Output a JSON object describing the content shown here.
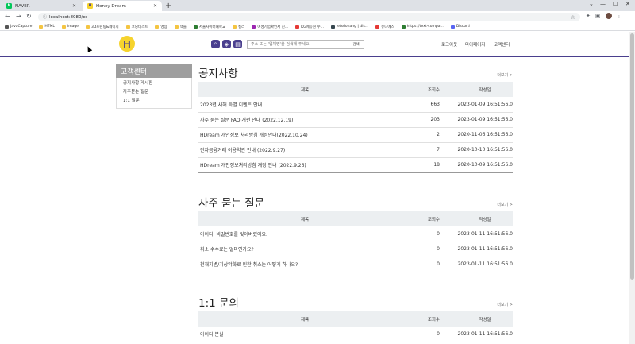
{
  "browser": {
    "tabs": [
      {
        "label": "NAVER",
        "favicon": "N",
        "color": "#03c75a"
      },
      {
        "label": "Honey Dream",
        "favicon": "H",
        "color": "#f6d32d"
      }
    ],
    "url": "localhost:8080/cs",
    "bookmarks": [
      {
        "label": "JavaCapture",
        "color": "#555555"
      },
      {
        "label": "HTML",
        "color": "#f4c542"
      },
      {
        "label": "image",
        "color": "#f4c542"
      },
      {
        "label": "3D프린팅&페이지",
        "color": "#f4c542"
      },
      {
        "label": "코딩테스트",
        "color": "#f4c542"
      },
      {
        "label": "영상",
        "color": "#f4c542"
      },
      {
        "label": "책들",
        "color": "#f4c542"
      },
      {
        "label": "서울사이버대학교",
        "color": "#2e7d32"
      },
      {
        "label": "컬러",
        "color": "#f4c542"
      },
      {
        "label": "여성기업확인서 신...",
        "color": "#9c27b0"
      },
      {
        "label": "KG에듀원 수...",
        "color": "#e53935"
      },
      {
        "label": "letsdohang | dis...",
        "color": "#37474f"
      },
      {
        "label": "유니에스",
        "color": "#e53935"
      },
      {
        "label": "https://text-compa...",
        "color": "#2e7d32"
      },
      {
        "label": "Discord",
        "color": "#5865f2"
      }
    ]
  },
  "header": {
    "logo": "H",
    "search_placeholder": "주소 또는 '업체명'을 검색해 주세요",
    "search_button": "검색",
    "nav": [
      "로그아웃",
      "마이페이지",
      "고객센터"
    ]
  },
  "sidebar": {
    "title": "고객센터",
    "items": [
      {
        "label": "공지사항 게시판"
      },
      {
        "label": "자주묻는 질문"
      },
      {
        "label": "1:1 질문"
      }
    ]
  },
  "columns": {
    "title": "제목",
    "views": "조회수",
    "date": "작성일"
  },
  "notice": {
    "title": "공지사항",
    "more": "더보기 >",
    "rows": [
      {
        "title": "2023년 새해 특별 이벤트 안내",
        "views": "663",
        "date": "2023-01-09 16:51:56.0"
      },
      {
        "title": "자주 묻는 질문 FAQ 개편 안내 (2022.12.19)",
        "views": "203",
        "date": "2023-01-09 16:51:56.0"
      },
      {
        "title": "HDream 개인정보 처리방침 개정안내(2022.10.24)",
        "views": "2",
        "date": "2020-11-06 16:51:56.0"
      },
      {
        "title": "전자금융거래 이용약관 안내 (2022.9.27)",
        "views": "7",
        "date": "2020-10-10 16:51:56.0"
      },
      {
        "title": "HDream 개인정보처리방침 개정 안내 (2022.9.26)",
        "views": "18",
        "date": "2020-10-09 16:51:56.0"
      }
    ]
  },
  "faq": {
    "title": "자주 묻는 질문",
    "more": "더보기 >",
    "rows": [
      {
        "title": "아이디, 비밀번호를 잊어버렸어요.",
        "views": "0",
        "date": "2023-01-11 16:51:56.0"
      },
      {
        "title": "취소 수수료는 얼마인가요?",
        "views": "0",
        "date": "2023-01-11 16:51:56.0"
      },
      {
        "title": "천재지변/기상악화로 인한 취소는 어떻게 하나요?",
        "views": "0",
        "date": "2023-01-11 16:51:56.0"
      }
    ]
  },
  "qna": {
    "title": "1:1 문의",
    "more": "더보기 >",
    "rows": [
      {
        "title": "아이디 분실",
        "views": "0",
        "date": "2023-01-11 16:51:56.0"
      }
    ]
  }
}
